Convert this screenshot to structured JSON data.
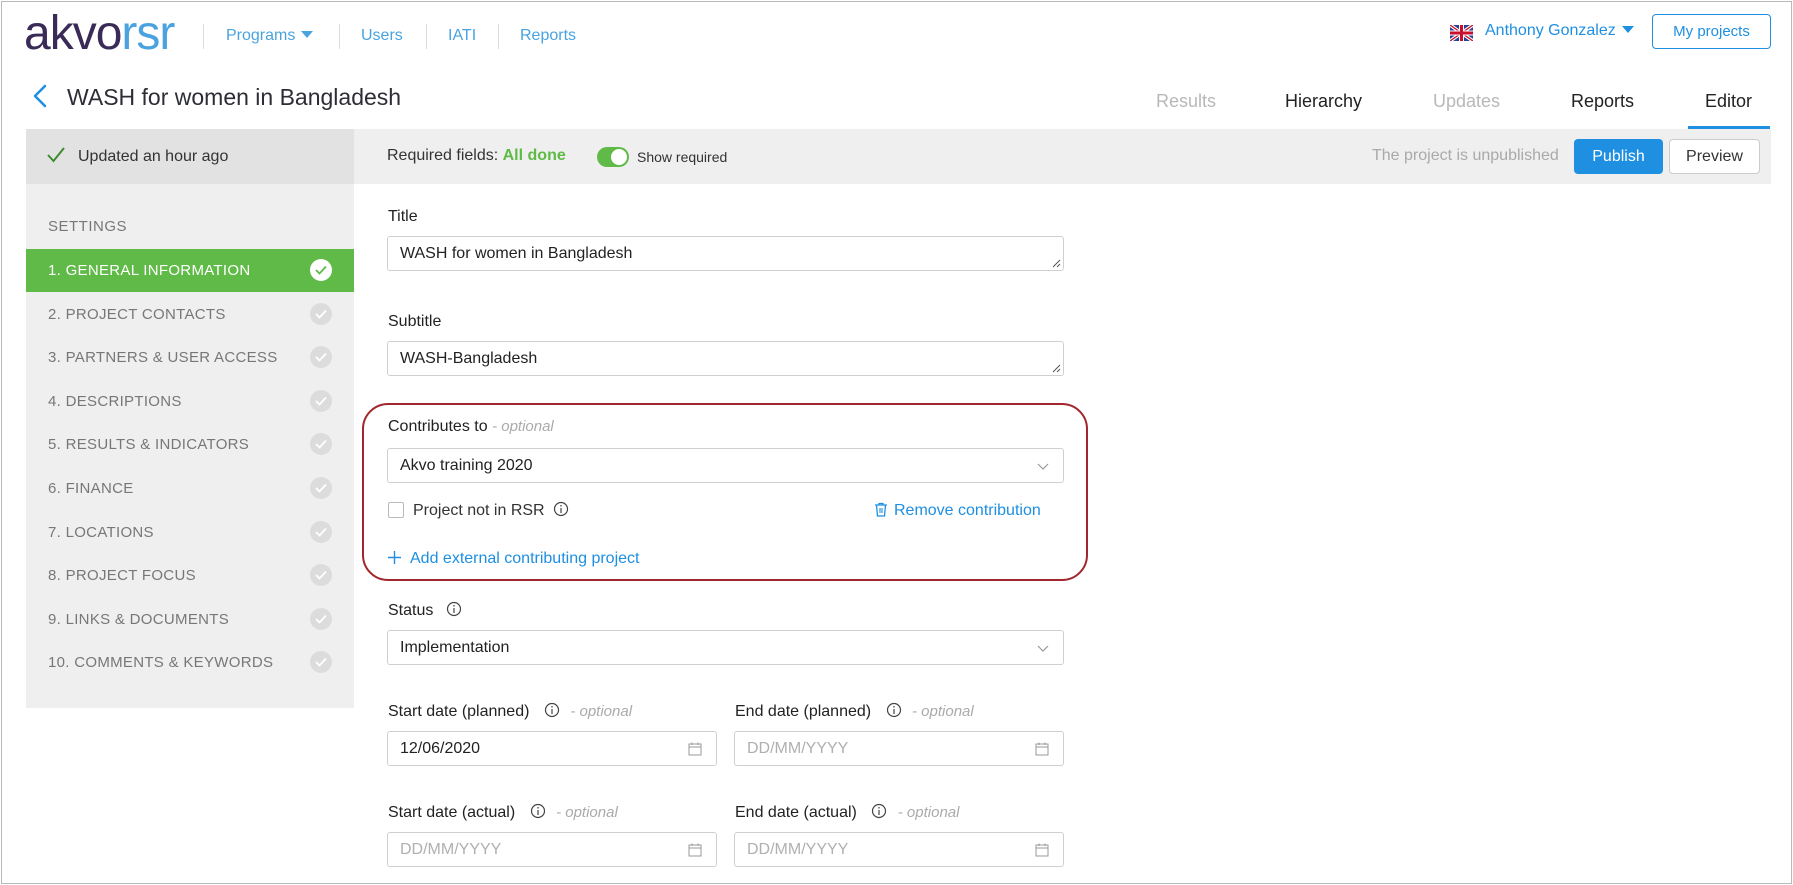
{
  "nav": {
    "logo_part1": "akvo",
    "logo_part2": "rsr",
    "links": [
      "Programs",
      "Users",
      "IATI",
      "Reports"
    ],
    "user_name": "Anthony Gonzalez",
    "my_projects": "My projects"
  },
  "project": {
    "title": "WASH for women in Bangladesh",
    "tabs": [
      {
        "label": "Results",
        "state": "disabled"
      },
      {
        "label": "Hierarchy",
        "state": "enabled"
      },
      {
        "label": "Updates",
        "state": "disabled"
      },
      {
        "label": "Reports",
        "state": "enabled"
      },
      {
        "label": "Editor",
        "state": "active"
      }
    ]
  },
  "statusbar": {
    "updated": "Updated an hour ago",
    "required_label": "Required fields:",
    "required_status": "All done",
    "show_required": "Show required",
    "unpublished": "The project is unpublished",
    "publish": "Publish",
    "preview": "Preview"
  },
  "sidebar": {
    "heading": "SETTINGS",
    "items": [
      "1. GENERAL INFORMATION",
      "2. PROJECT CONTACTS",
      "3. PARTNERS & USER ACCESS",
      "4. DESCRIPTIONS",
      "5. RESULTS & INDICATORS",
      "6. FINANCE",
      "7. LOCATIONS",
      "8. PROJECT FOCUS",
      "9. LINKS & DOCUMENTS",
      "10. COMMENTS & KEYWORDS"
    ],
    "active_index": 0
  },
  "form": {
    "optional": "- optional",
    "title_label": "Title",
    "title_value": "WASH for women in Bangladesh",
    "subtitle_label": "Subtitle",
    "subtitle_value": "WASH-Bangladesh",
    "contributes_label": "Contributes to",
    "contributes_value": "Akvo training 2020",
    "not_in_rsr": "Project not in RSR",
    "remove_contribution": "Remove contribution",
    "add_external": "Add external contributing project",
    "status_label": "Status",
    "status_value": "Implementation",
    "start_planned_label": "Start date (planned)",
    "start_planned_value": "12/06/2020",
    "end_planned_label": "End date (planned)",
    "start_actual_label": "Start date (actual)",
    "end_actual_label": "End date (actual)",
    "date_placeholder": "DD/MM/YYYY"
  },
  "colors": {
    "accent_blue": "#1e8fe1",
    "success_green": "#5fba47",
    "highlight_red": "#a1262d"
  }
}
